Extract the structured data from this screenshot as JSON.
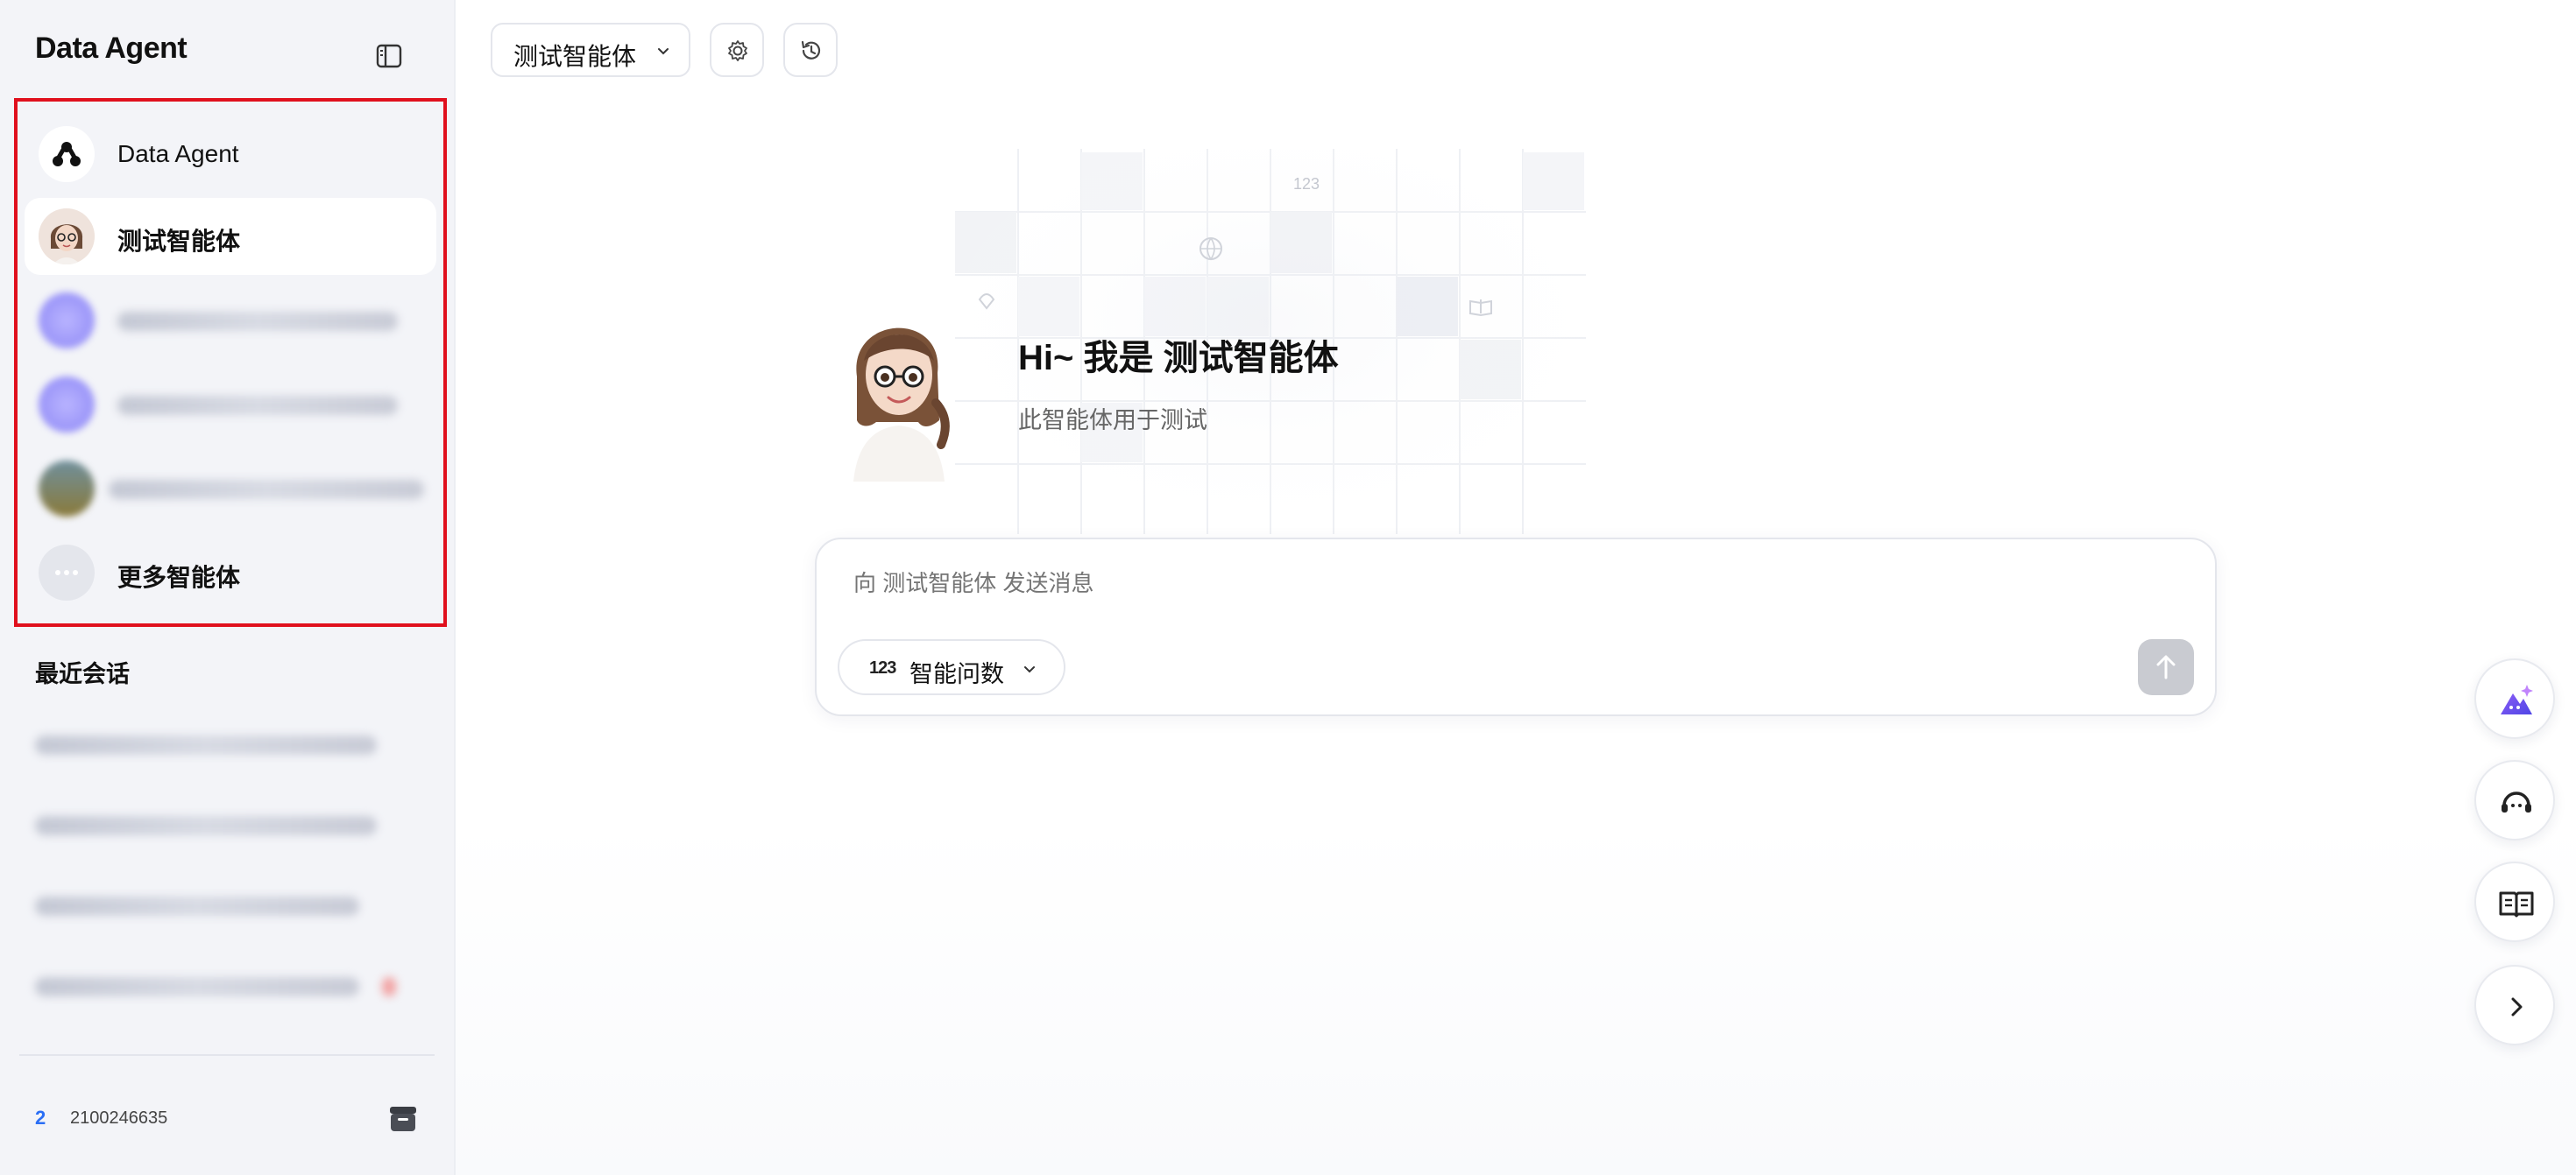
{
  "sidebar": {
    "brand": "Data Agent",
    "agents": [
      {
        "name": "Data Agent",
        "active": false,
        "icon": "data-agent-logo"
      },
      {
        "name": "测试智能体",
        "active": true,
        "icon": "avatar-girl"
      },
      {
        "name": "",
        "blurred": true
      },
      {
        "name": "",
        "blurred": true
      },
      {
        "name": "",
        "blurred": true
      },
      {
        "name": "更多智能体",
        "active": false,
        "icon": "more-dots-icon"
      }
    ],
    "recent_title": "最近会话",
    "user_badge": "2",
    "user_id": "2100246635"
  },
  "header": {
    "agent_select_label": "测试智能体"
  },
  "hero": {
    "title": "Hi~ 我是 测试智能体",
    "subtitle": "此智能体用于测试"
  },
  "composer": {
    "placeholder": "向 测试智能体 发送消息",
    "mode_icon": "123",
    "mode_label": "智能问数"
  },
  "colors": {
    "accent_red_outline": "#e0101d",
    "sidebar_bg": "#f3f4f8",
    "send_disabled": "#c9cbd1"
  }
}
